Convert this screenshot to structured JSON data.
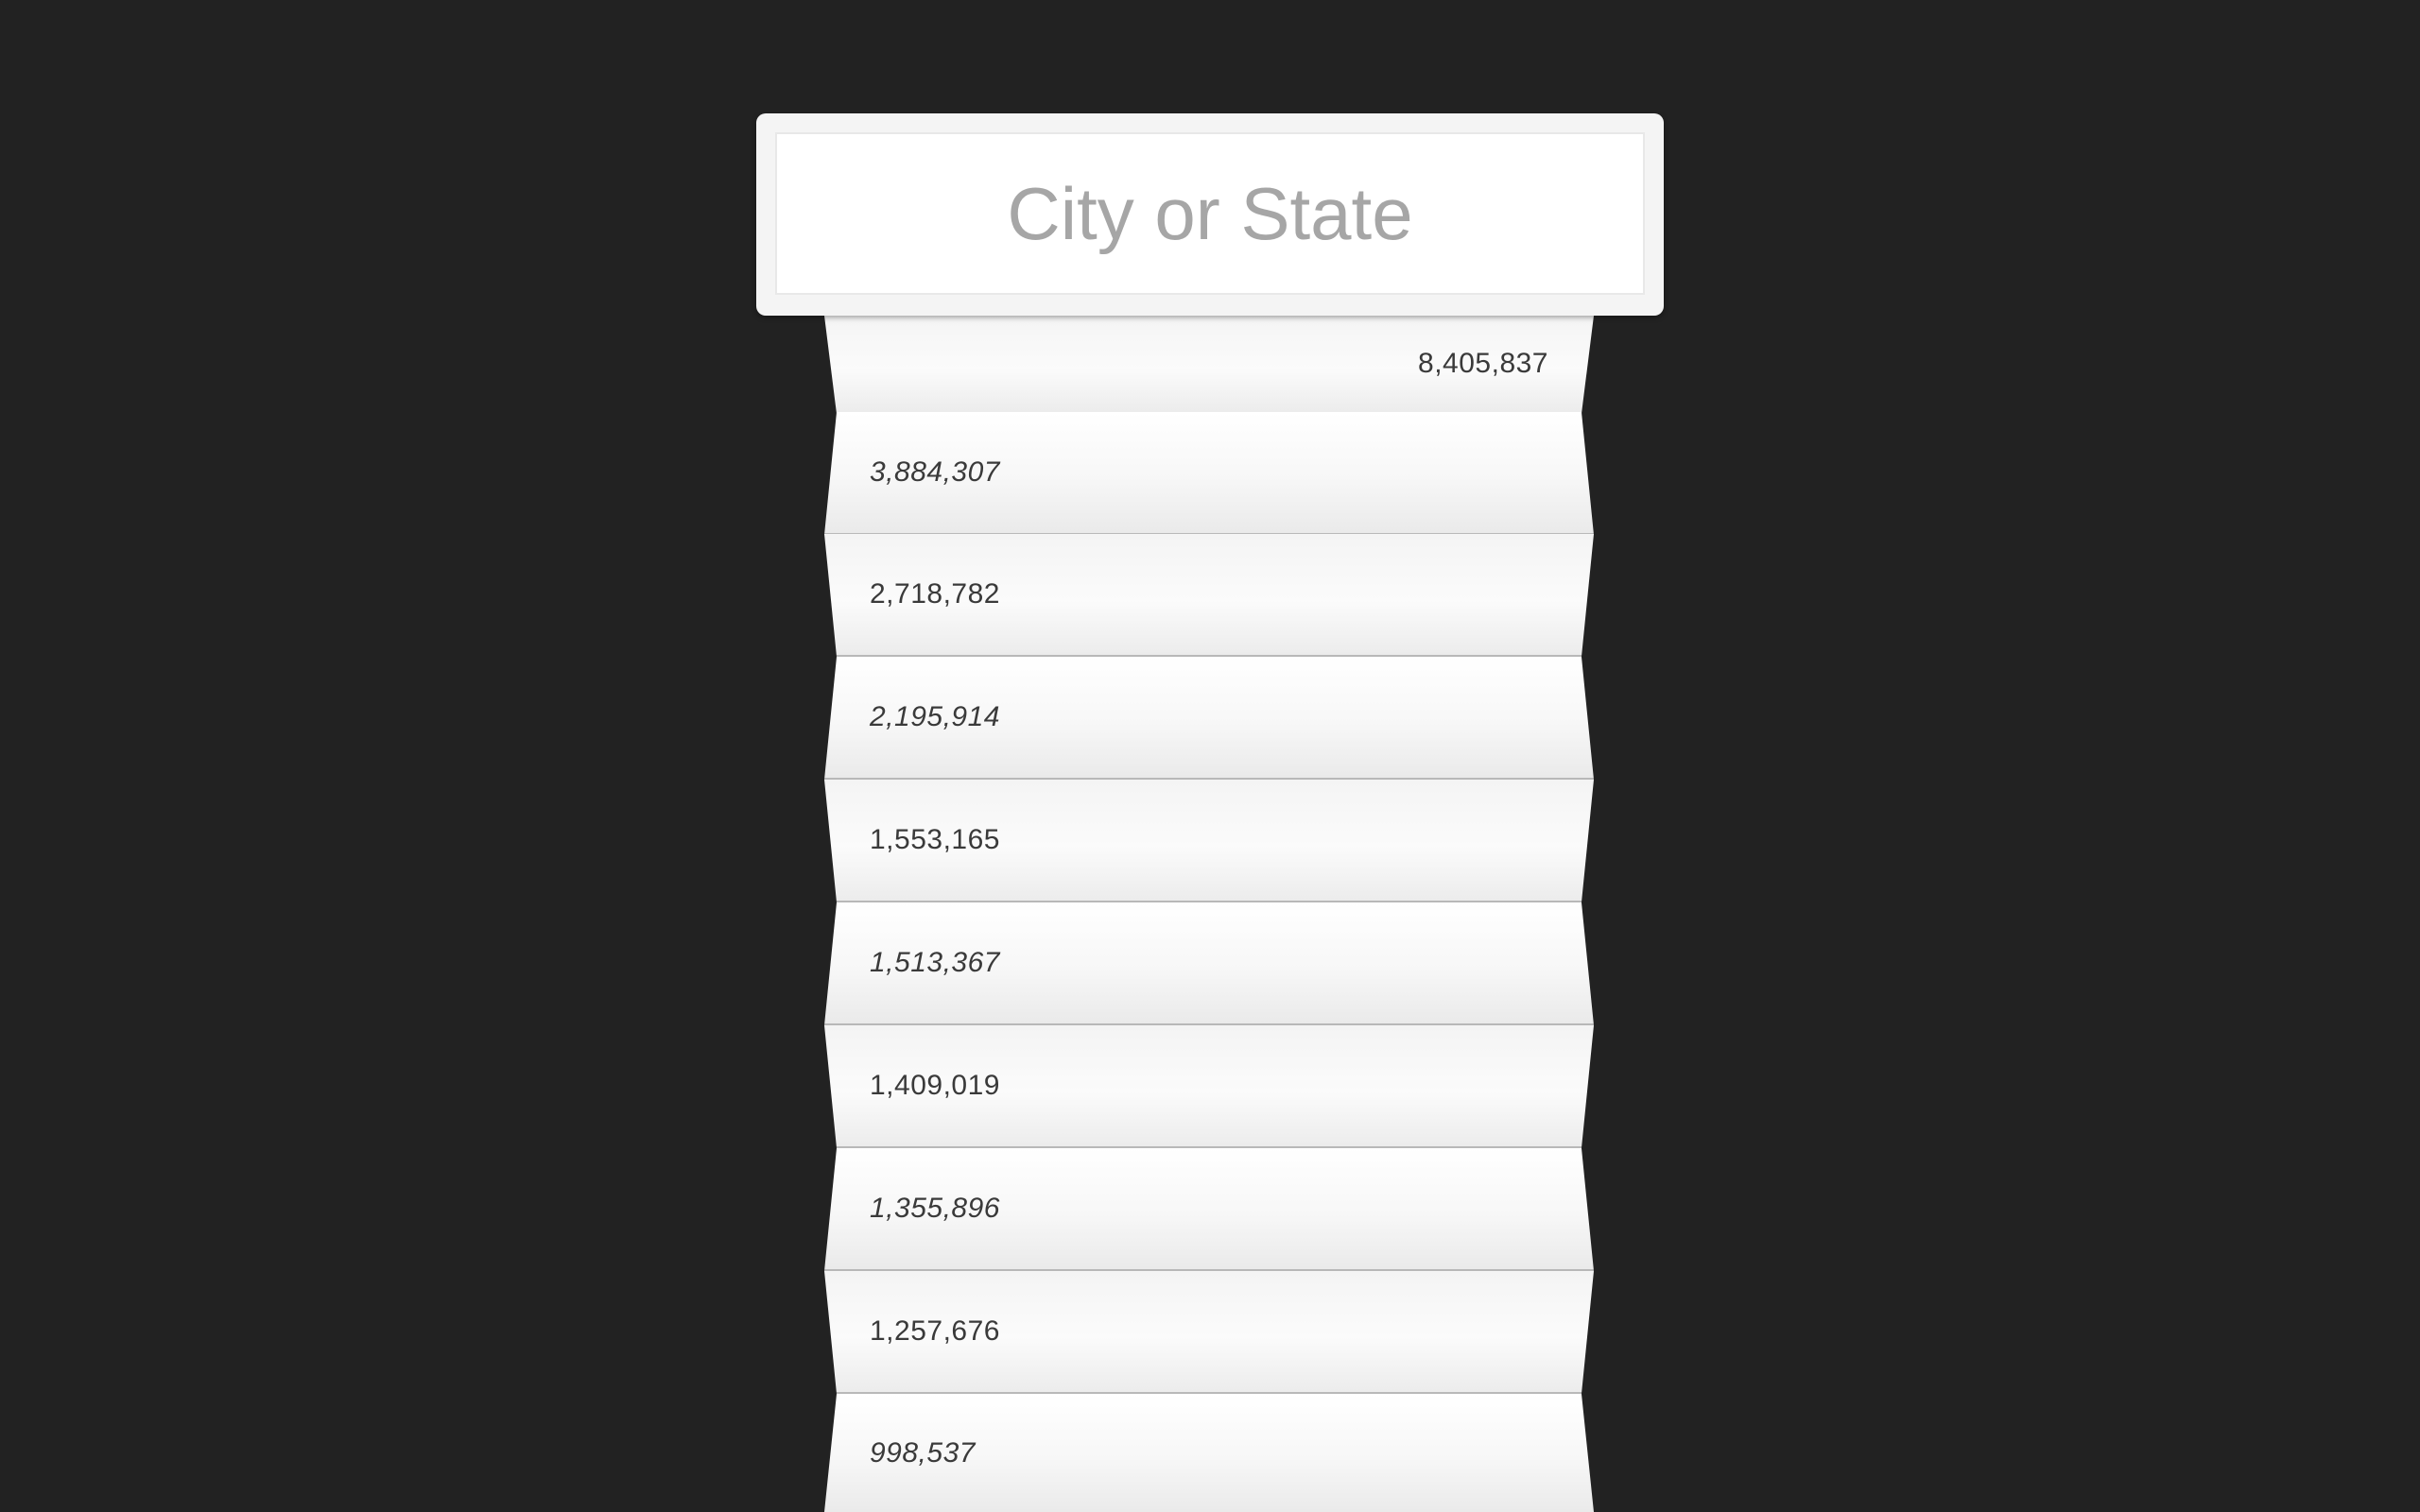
{
  "search": {
    "placeholder": "City or State",
    "value": ""
  },
  "results": [
    {
      "population": "8,405,837"
    },
    {
      "population": "3,884,307"
    },
    {
      "population": "2,718,782"
    },
    {
      "population": "2,195,914"
    },
    {
      "population": "1,553,165"
    },
    {
      "population": "1,513,367"
    },
    {
      "population": "1,409,019"
    },
    {
      "population": "1,355,896"
    },
    {
      "population": "1,257,676"
    },
    {
      "population": "998,537"
    }
  ],
  "colors": {
    "background": "#222222",
    "card": "#ffffff",
    "placeholder_text": "#a6a6a6",
    "row_text": "#3a3a3a"
  }
}
